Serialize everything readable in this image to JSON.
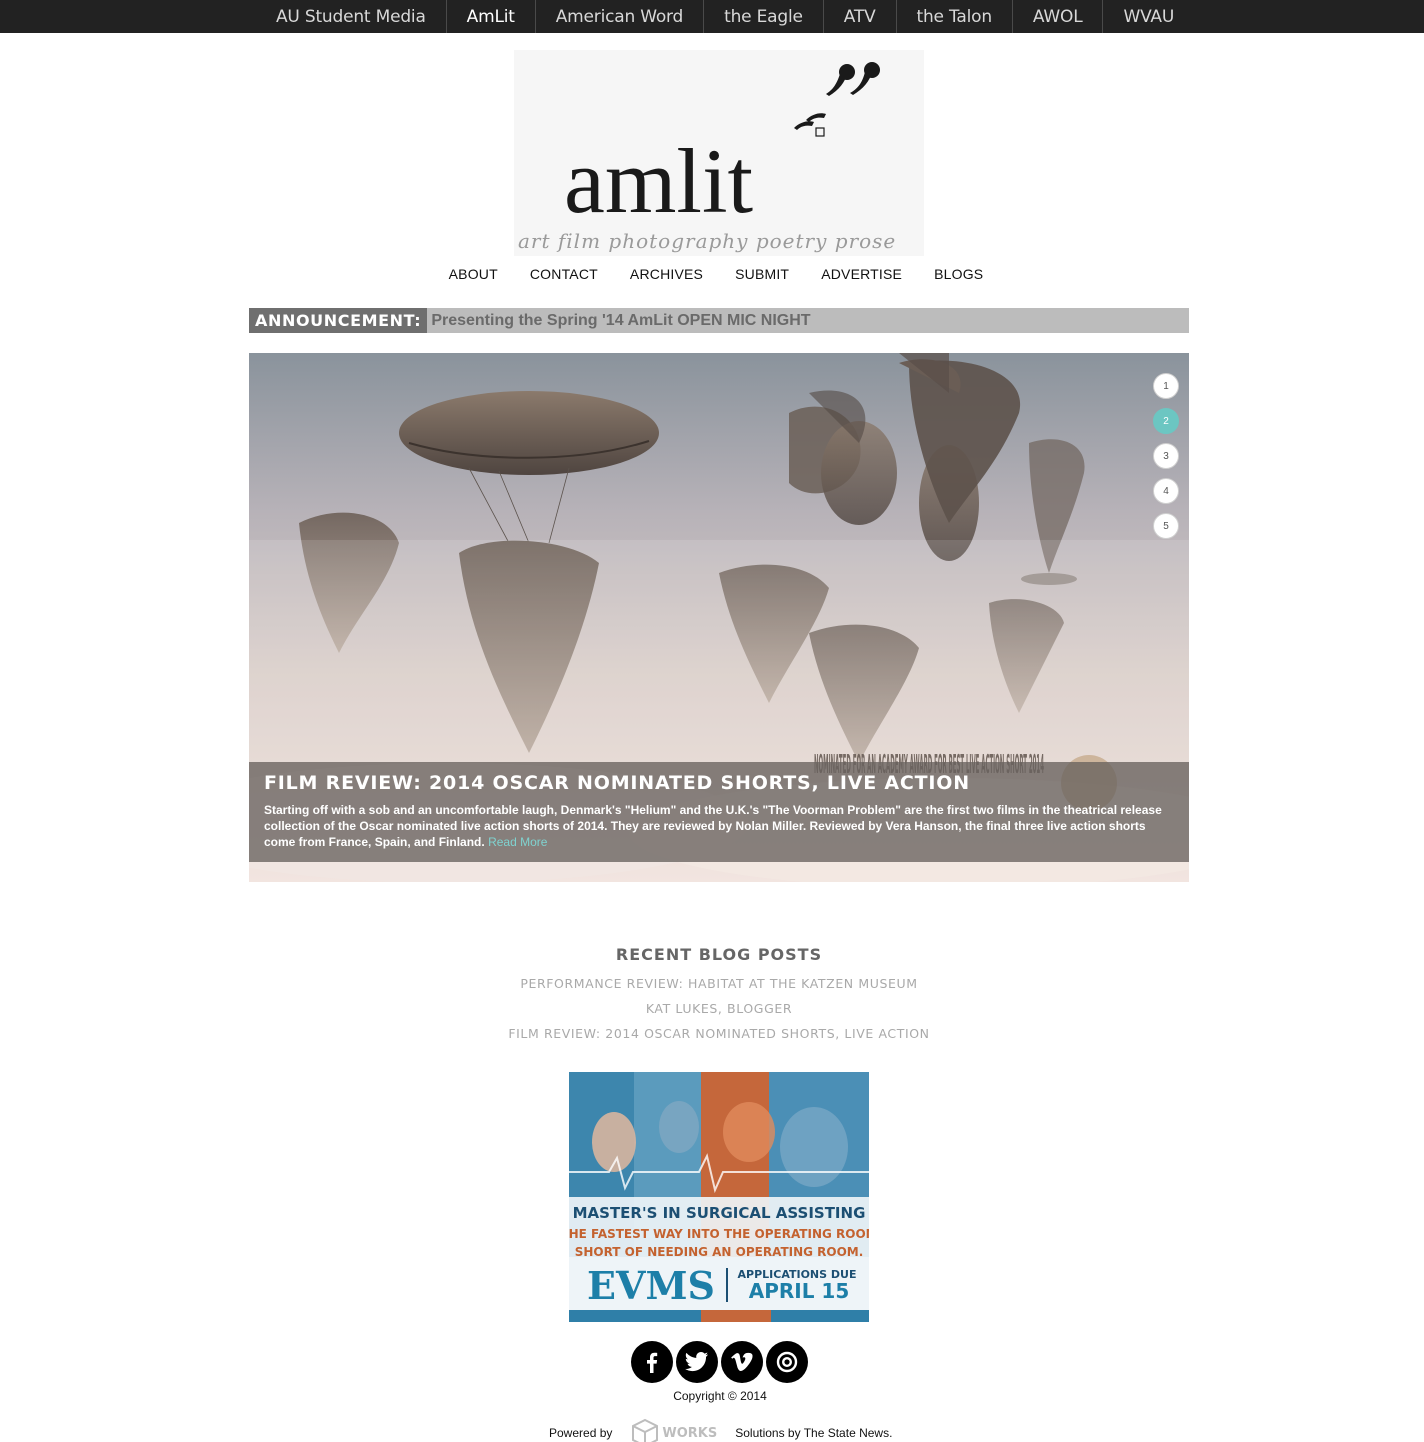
{
  "network_nav": {
    "items": [
      {
        "label": "AU Student Media",
        "active": false
      },
      {
        "label": "AmLit",
        "active": true
      },
      {
        "label": "American Word",
        "active": false
      },
      {
        "label": "the Eagle",
        "active": false
      },
      {
        "label": "ATV",
        "active": false
      },
      {
        "label": "the Talon",
        "active": false
      },
      {
        "label": "AWOL",
        "active": false
      },
      {
        "label": "WVAU",
        "active": false
      }
    ]
  },
  "logo": {
    "wordmark": "amlit",
    "tagline": "art  film  photography  poetry  prose"
  },
  "main_nav": {
    "items": [
      "ABOUT",
      "CONTACT",
      "ARCHIVES",
      "SUBMIT",
      "ADVERTISE",
      "BLOGS"
    ]
  },
  "announcement": {
    "tag": "ANNOUNCEMENT:",
    "text": "Presenting the Spring '14 AmLit OPEN MIC NIGHT"
  },
  "slider": {
    "dots": [
      "1",
      "2",
      "3",
      "4",
      "5"
    ],
    "active_dot": "2",
    "accent_color": "#6cc6c2",
    "image_overlay_text": "NOMINATED FOR AN ACADEMY AWARD FOR BEST LIVE ACTION SHORT 2014",
    "caption": {
      "title": "FILM REVIEW: 2014 OSCAR NOMINATED SHORTS, LIVE ACTION",
      "body": "Starting off with a sob and an uncomfortable laugh, Denmark's \"Helium\" and the U.K.'s \"The Voorman Problem\" are the first two films in the theatrical release collection of the Oscar nominated live action shorts of 2014. They are reviewed by Nolan Miller. Reviewed by Vera Hanson, the final three live action shorts come from France, Spain, and Finland.",
      "read_more": "Read More"
    }
  },
  "recent_posts": {
    "heading": "RECENT BLOG POSTS",
    "items": [
      "PERFORMANCE REVIEW: HABITAT AT THE KATZEN MUSEUM",
      "KAT LUKES, BLOGGER",
      "FILM REVIEW: 2014 OSCAR NOMINATED SHORTS, LIVE ACTION"
    ]
  },
  "ad": {
    "headline": "MASTER'S IN SURGICAL ASSISTING",
    "line1": "THE FASTEST WAY INTO THE OPERATING ROOM",
    "line2": "SHORT OF NEEDING AN OPERATING ROOM.",
    "brand": "EVMS",
    "deadline_label": "APPLICATIONS DUE",
    "deadline_date": "APRIL 15"
  },
  "social": {
    "icons": [
      "facebook-icon",
      "twitter-icon",
      "vimeo-icon",
      "instagram-icon"
    ]
  },
  "footer": {
    "copyright": "Copyright © 2014",
    "powered_by": "Powered by",
    "works_label": "WORKS",
    "solutions": "Solutions by The State News."
  }
}
